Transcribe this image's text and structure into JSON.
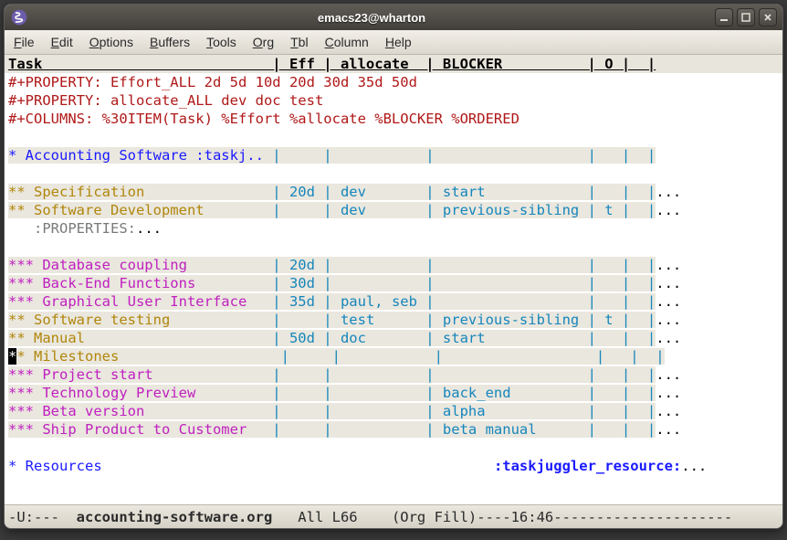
{
  "window": {
    "title": "emacs23@wharton"
  },
  "menu": {
    "items": [
      "File",
      "Edit",
      "Options",
      "Buffers",
      "Tools",
      "Org",
      "Tbl",
      "Column",
      "Help"
    ]
  },
  "columns": {
    "header": "Task                           | Eff | allocate  | BLOCKER          | O |  |"
  },
  "config_lines": {
    "l1": "#+PROPERTY: Effort_ALL 2d 5d 10d 20d 30d 35d 50d",
    "l2": "#+PROPERTY: allocate_ALL dev doc test",
    "l3": "#+COLUMNS: %30ITEM(Task) %Effort %allocate %BLOCKER %ORDERED"
  },
  "rows": {
    "acct_task": "* Accounting Software :taskj..",
    "acct_rest": " |     |           |                  |   |  |",
    "spec_task": "** Specification              ",
    "spec_rest": " | 20d | dev       | start            |   |  |",
    "spec_dots": "...",
    "sdev_task": "** Software Development       ",
    "sdev_rest": " |     | dev       | previous-sibling | t |  |",
    "sdev_dots": "...",
    "props": "   :PROPERTIES:",
    "props_dots": "...",
    "db_task": "*** Database coupling         ",
    "db_rest": " | 20d |           |                  |   |  |",
    "db_dots": "...",
    "be_task": "*** Back-End Functions        ",
    "be_rest": " | 30d |           |                  |   |  |",
    "be_dots": "...",
    "gui_task": "*** Graphical User Interface  ",
    "gui_rest": " | 35d | paul, seb |                  |   |  |",
    "gui_dots": "...",
    "stest_task": "** Software testing           ",
    "stest_rest": " |     | test      | previous-sibling | t |  |",
    "stest_dots": "...",
    "man_task": "** Manual                     ",
    "man_rest": " | 50d | doc       | start            |   |  |",
    "man_dots": "...",
    "mile_cursor": "*",
    "mile_task": "* Milestones                  ",
    "mile_rest": " |     |           |                  |   |  |",
    "ps_task": "*** Project start             ",
    "ps_rest": " |     |           |                  |   |  |",
    "ps_dots": "...",
    "tp_task": "*** Technology Preview        ",
    "tp_rest": " |     |           | back_end         |   |  |",
    "tp_dots": "...",
    "bv_task": "*** Beta version              ",
    "bv_rest": " |     |           | alpha            |   |  |",
    "bv_dots": "...",
    "ship_task": "*** Ship Product to Customer  ",
    "ship_rest": " |     |           | beta manual      |   |  |",
    "ship_dots": "...",
    "res_star": "*",
    "res_task": " Resources                                              ",
    "res_tag": ":taskjuggler_resource:",
    "res_dots": "..."
  },
  "modeline": {
    "left": "-U:---  ",
    "buffer": "accounting-software.org",
    "mid": "   All L66    (Org Fill)----16:46---------------------"
  }
}
